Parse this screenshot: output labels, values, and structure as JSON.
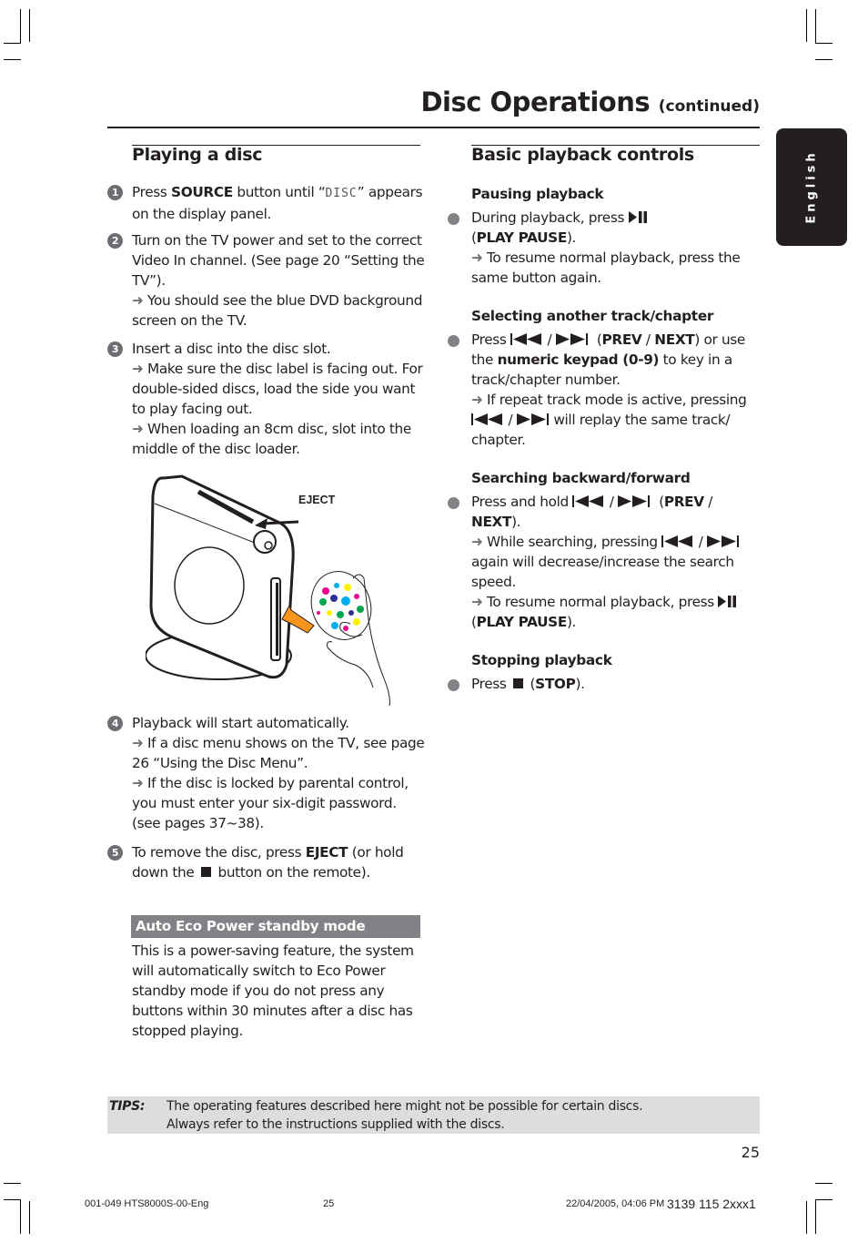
{
  "header": {
    "title": "Disc Operations",
    "title_suffix": "(continued)"
  },
  "language_tab": {
    "label": "English"
  },
  "left": {
    "heading": "Playing a disc",
    "steps": [
      {
        "num": "1",
        "parts": {
          "a": "Press ",
          "b": "SOURCE",
          "c": " button until “",
          "lcd": "DISC",
          "d": "” appears on the display panel."
        }
      },
      {
        "num": "2",
        "line1": "Turn on the TV power and set to the correct Video In channel.  (See page 20 “Setting the TV”).",
        "note1": " You should see the blue DVD background screen on the TV."
      },
      {
        "num": "3",
        "line1": "Insert a disc into the disc slot.",
        "note1": " Make sure the disc label is facing out. For double-sided discs, load the side you want to play facing out.",
        "note2": " When loading an 8cm disc, slot into the middle of the disc loader."
      },
      {
        "num": "4",
        "line1": "Playback will start automatically.",
        "note1": " If a disc menu shows on the TV, see page 26 “Using the Disc Menu”.",
        "note2": " If the disc is locked by parental control, you must enter your six-digit password. (see pages 37~38)."
      },
      {
        "num": "5",
        "parts": {
          "a": "To remove the disc, press ",
          "b": "EJECT",
          "c": " (or hold down the ",
          "d": " button on the remote)."
        }
      }
    ],
    "illustration": {
      "eject_label": "EJECT"
    },
    "eco": {
      "heading": "Auto Eco Power standby mode",
      "text": "This is a power-saving feature, the system will automatically switch to Eco Power standby mode if you do not press any buttons within 30 minutes after a disc has stopped playing."
    }
  },
  "right": {
    "heading": "Basic playback controls",
    "sections": [
      {
        "title": "Pausing playback",
        "a": "During playback, press ",
        "key": "PLAY PAUSE",
        "note1": " To resume normal playback, press the same button again."
      },
      {
        "title": "Selecting another track/chapter",
        "a": "Press ",
        "key1": "PREV",
        "sep": " / ",
        "key2": "NEXT",
        "b": ") or use the ",
        "key3": "numeric keypad (0-9)",
        "c": " to key in a track/chapter number.",
        "note1": " If repeat track mode is active, pressing ",
        "note1b": " will replay the same track/ chapter."
      },
      {
        "title": "Searching backward/forward",
        "a": "Press and hold ",
        "key1": "PREV",
        "key2": "NEXT",
        "note1": " While searching, pressing ",
        "note1b": " again will decrease/increase the search speed.",
        "note2": " To resume normal playback, press ",
        "key3": "PLAY PAUSE"
      },
      {
        "title": "Stopping playback",
        "a": "Press ",
        "key": "STOP"
      }
    ]
  },
  "tips": {
    "label": "TIPS:",
    "line1": "The operating features described here might not be possible for certain discs.",
    "line2": "Always refer to the instructions supplied with the discs."
  },
  "page_number": "25",
  "footer": {
    "file": "001-049 HTS8000S-00-Eng",
    "page": "25",
    "date": "22/04/2005, 04:06 PM",
    "code": "3139 115 2xxx1"
  },
  "icons": {
    "play_pause": "play-pause-icon",
    "prev": "previous-icon",
    "next": "next-icon",
    "stop": "stop-icon",
    "arrow": "arrow-right-icon"
  }
}
